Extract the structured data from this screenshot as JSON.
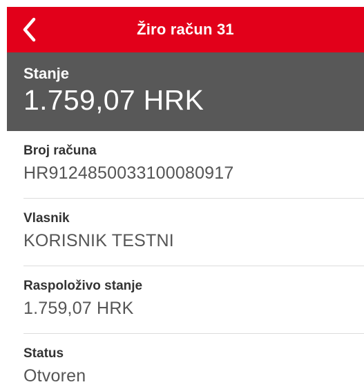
{
  "header": {
    "title": "Žiro račun 31",
    "back_icon": "chevron-left-icon",
    "background_color": "#e2001a"
  },
  "balance": {
    "label": "Stanje",
    "value": "1.759,07 HRK",
    "background_color": "#585858"
  },
  "details": [
    {
      "label": "Broj računa",
      "value": "HR9124850033100080917"
    },
    {
      "label": "Vlasnik",
      "value": "KORISNIK TESTNI"
    },
    {
      "label": "Raspoloživo stanje",
      "value": "1.759,07 HRK"
    },
    {
      "label": "Status",
      "value": "Otvoren"
    }
  ]
}
